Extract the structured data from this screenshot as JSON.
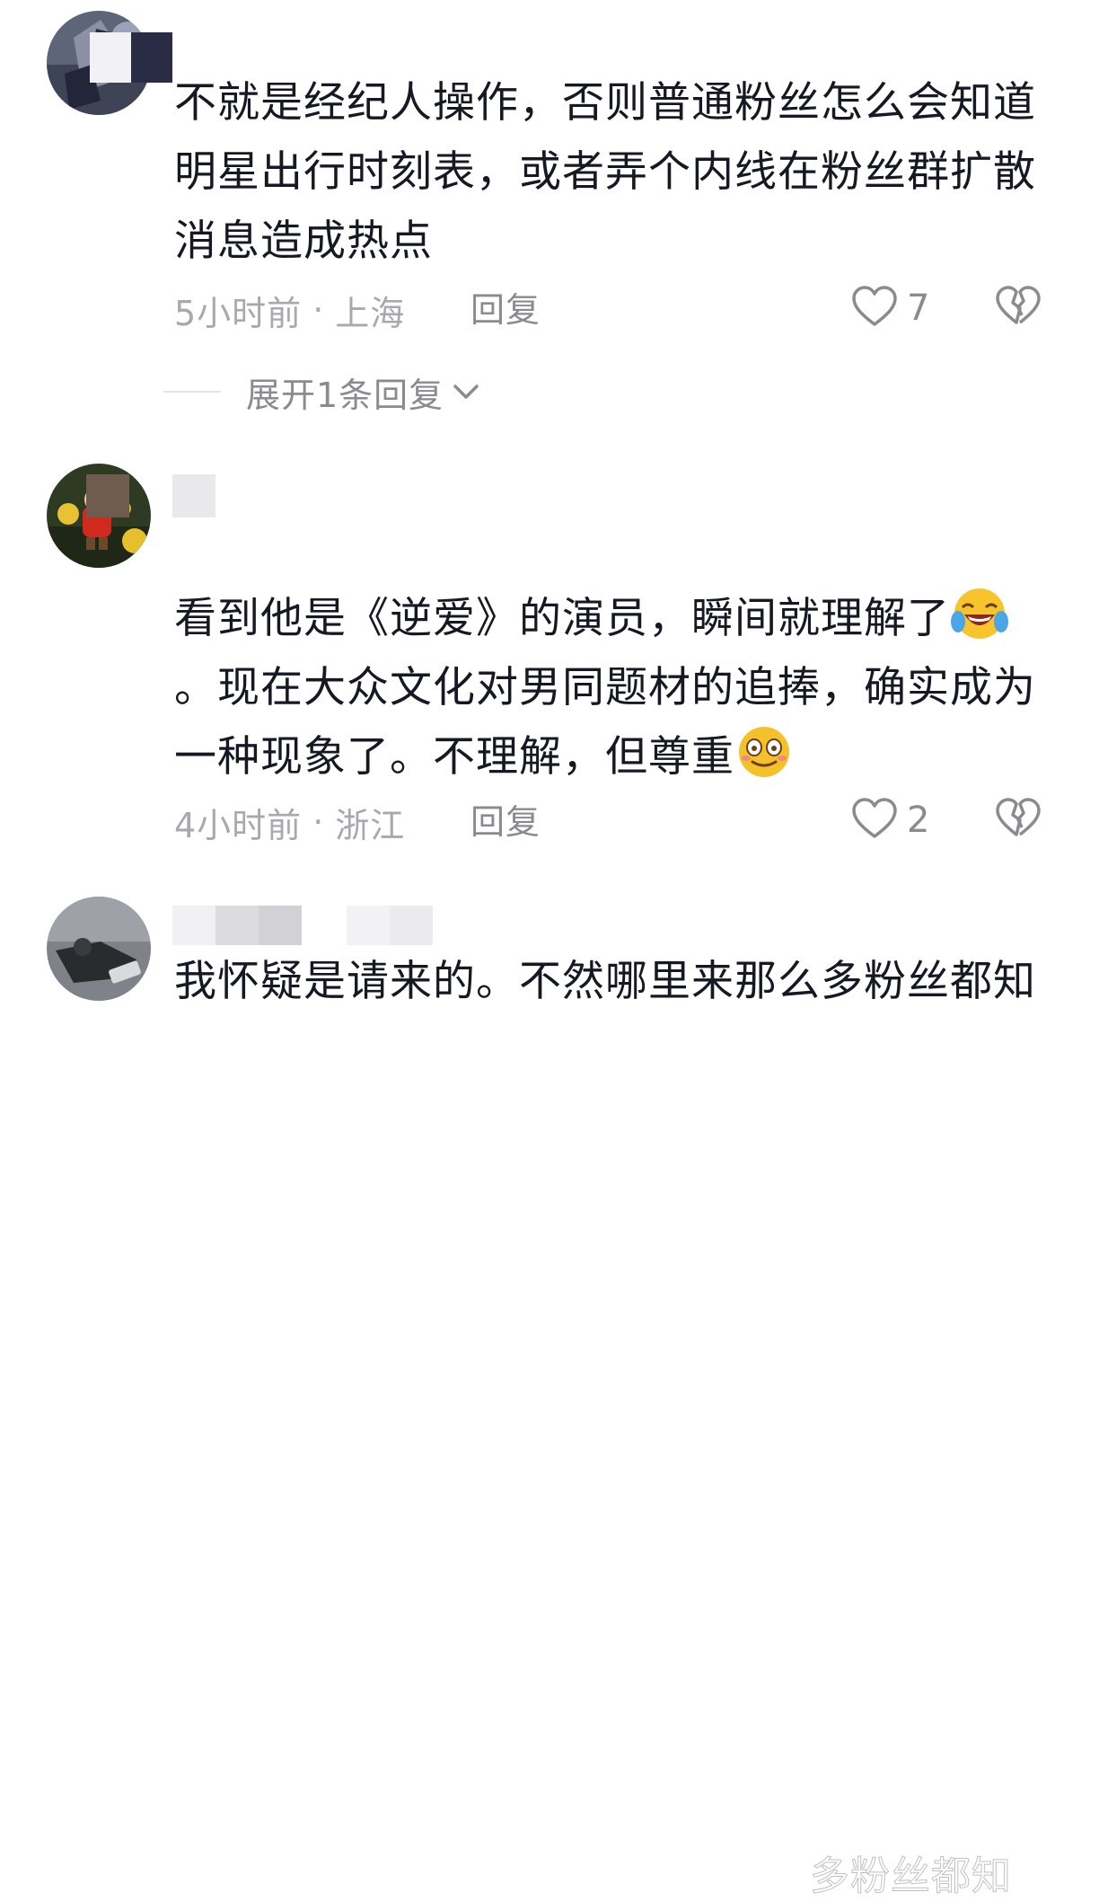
{
  "comments": [
    {
      "text": "不就是经纪人操作，否则普通粉丝怎么会知道明星出行时刻表，或者弄个内线在粉丝群扩散消息造成热点",
      "time": "5小时前",
      "separator": "·",
      "location": "上海",
      "reply_label": "回复",
      "likes": "7"
    },
    {
      "text_part1": "看到他是《逆爱》的演员，瞬间就理解了",
      "text_part2": "。现在大众文化对男同题材的追捧，确实成为一种现象了。不理解，但尊重",
      "time": "4小时前",
      "separator": "·",
      "location": "浙江",
      "reply_label": "回复",
      "likes": "2"
    },
    {
      "text": "我怀疑是请来的。不然哪里来那么多粉丝都知"
    }
  ],
  "expand_replies": {
    "label": "展开1条回复"
  },
  "watermark": "多粉丝都知",
  "icons": {
    "like": "heart-outline-icon",
    "dislike": "broken-heart-outline-icon",
    "expand": "chevron-down-icon"
  },
  "colors": {
    "text": "#161823",
    "meta": "#a8a9ae",
    "action": "#8a8b91"
  }
}
